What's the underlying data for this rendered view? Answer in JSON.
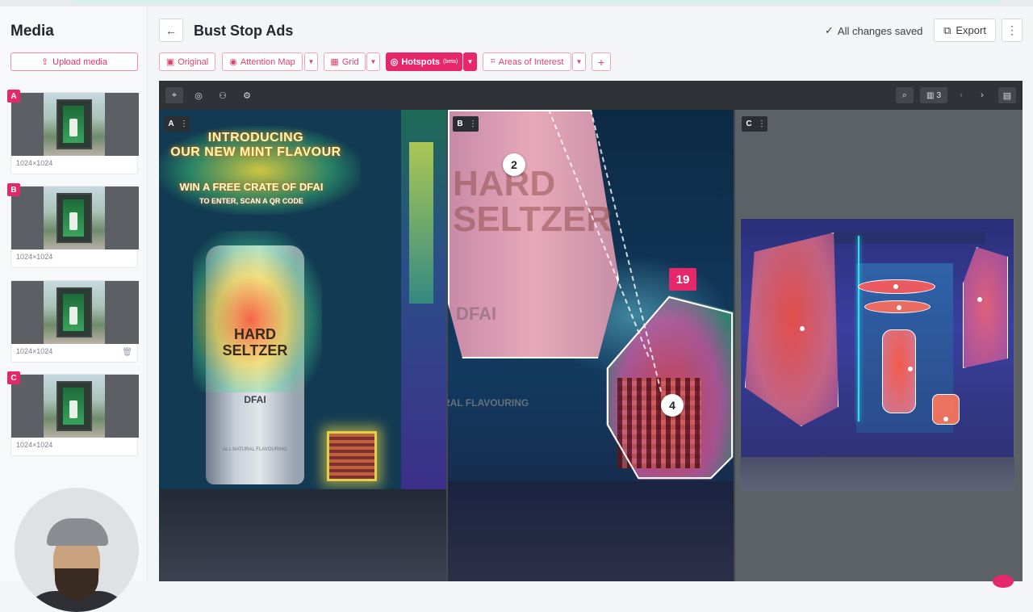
{
  "sidebar": {
    "title": "Media",
    "upload_label": "Upload media",
    "items": [
      {
        "badge": "A",
        "dims": "1024×1024"
      },
      {
        "badge": "B",
        "dims": "1024×1024"
      },
      {
        "badge": "",
        "dims": "1024×1024"
      },
      {
        "badge": "C",
        "dims": "1024×1024"
      }
    ]
  },
  "header": {
    "title": "Bust Stop Ads",
    "saved_status": "All changes saved",
    "export_label": "Export"
  },
  "toolbar": {
    "original": "Original",
    "attention_map": "Attention Map",
    "grid": "Grid",
    "hotspots": "Hotspots",
    "hotspots_beta": "(beta)",
    "areas_of_interest": "Areas of Interest",
    "add": "+"
  },
  "viewer": {
    "columns_count": "3",
    "panels": [
      {
        "label": "A",
        "headline": "INTRODUCING\nOUR NEW MINT FLAVOUR",
        "offer": "WIN A FREE CRATE OF DFAI",
        "offer_sub": "TO ENTER, SCAN A QR CODE",
        "can_text": "HARD\nSELTZER",
        "can_brand": "DFAI",
        "can_small": "ALL NATURAL FLAVOURING"
      },
      {
        "label": "B",
        "can_text": "HARD\nSELTZER",
        "brand": "DFAI",
        "flavouring": "RAL FLAVOURING",
        "hotspot_2": "2",
        "hotspot_4": "4",
        "hotspot_19": "19"
      },
      {
        "label": "C"
      }
    ]
  },
  "colors": {
    "accent": "#e6286a",
    "viewer_bg": "#45494d"
  }
}
